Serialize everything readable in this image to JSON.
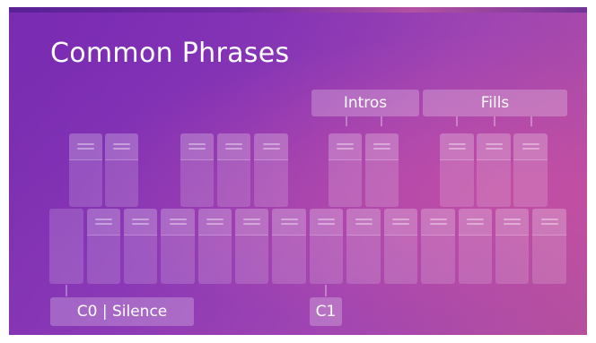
{
  "title": "Common Phrases",
  "groups": {
    "intros": "Intros",
    "fills": "Fills"
  },
  "markers": {
    "c0": "C0 | Silence",
    "c1": "C1"
  }
}
